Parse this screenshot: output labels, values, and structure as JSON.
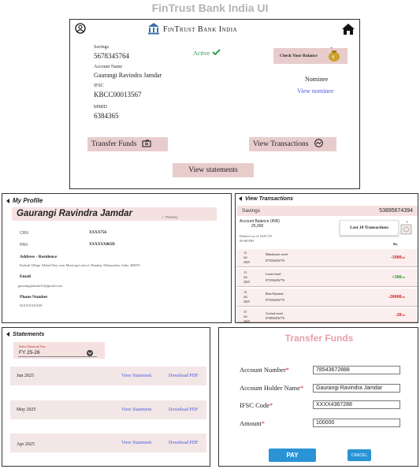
{
  "app_title": "FinTrust Bank India UI",
  "main": {
    "bank_name": "FinTrust Bank India",
    "savings_label": "Savings",
    "account_number": "5678345764",
    "status": "Active",
    "account_name_label": "Account Name",
    "account_name": "Gaurangi Ravindra Jamdar",
    "ifsc_label": "IFSC",
    "ifsc": "KBCC00013567",
    "mmid_label": "MMID",
    "mmid": "6384365",
    "check_balance_label": "Check Your Balance",
    "nominee_label": "Nominee",
    "view_nominee_label": "View nominee",
    "transfer_funds_label": "Transfer Funds",
    "view_transactions_label": "View Transactions",
    "view_statements_label": "View statements"
  },
  "profile": {
    "title": "My Profile",
    "name": "Gaurangi Ravindra Jamdar",
    "primary_label": "Primary",
    "crn_label": "CRN",
    "crn_value": "XXXX756",
    "pan_label": "PAN",
    "pan_value": "XXXXXX865D",
    "address_label": "Address - Residence",
    "address_value": "Rathodi Village ,Malad West, near Municipal school, Mumbai, Maharashtra, India, 400095",
    "email_label": "Email",
    "email_value": "gaurangijamdar23@gmail.com",
    "phone_label": "Phone Number",
    "phone_value": "92XXXXXX68"
  },
  "transactions": {
    "title": "View Transactions",
    "savings_label": "Savings",
    "account_number": "53895674394",
    "balance_label": "Account Balance (INR)",
    "balance_value": "25,000",
    "balance_asof": "Balance as of 16/07/25",
    "balance_time": "09:00 PM",
    "last10_label": "Last 10 Transactions",
    "currency_header": "Rs.",
    "rows": [
      {
        "day": "12",
        "month": "Jul 2025",
        "name": "Mahalaxmi sweet",
        "acc": "873556456776",
        "amount": "-1000",
        "decimal": ".00",
        "color": "#d42020"
      },
      {
        "day": "13",
        "month": "Jul 2025",
        "name": "Laxmi hotel",
        "acc": "873556456776",
        "amount": "+300",
        "decimal": ".00",
        "color": "#1f9a1f"
      },
      {
        "day": "14",
        "month": "Jul 2025",
        "name": "Rent Payment",
        "acc": "873556456776",
        "amount": "-20000",
        "decimal": ".00",
        "color": "#d42020"
      },
      {
        "day": "15",
        "month": "Jul 2025",
        "name": "Govind sweet",
        "acc": "873856456776",
        "amount": "-20",
        "decimal": ".00",
        "color": "#d42020"
      }
    ]
  },
  "statements": {
    "title": "Statements",
    "fy_label": "Select Financial Year",
    "fy_value": "FY 25-26",
    "view_label": "View Statement",
    "download_label": "Download PDF",
    "months": [
      "Jun 2025",
      "May 2025",
      "Apr 2025"
    ]
  },
  "transfer": {
    "title": "Transfer Funds",
    "account_number_label": "Account Number",
    "account_number_value": "78543672888",
    "holder_label": "Account Holder Name",
    "holder_value": "Gaurangi Ravindra Jamdar",
    "ifsc_label": "IFSC Code",
    "ifsc_value": "XXXX4367288",
    "amount_label": "Amount",
    "amount_value": "100000",
    "required_mark": "*",
    "pay_label": "PAY",
    "cancel_label": "CANCEL"
  },
  "colors": {
    "accent_pink": "#e8cccc",
    "link_blue": "#4a5ad6",
    "active_green": "#2ea04f",
    "pay_blue": "#2a93d5",
    "transfer_title": "#e8a0a8"
  }
}
